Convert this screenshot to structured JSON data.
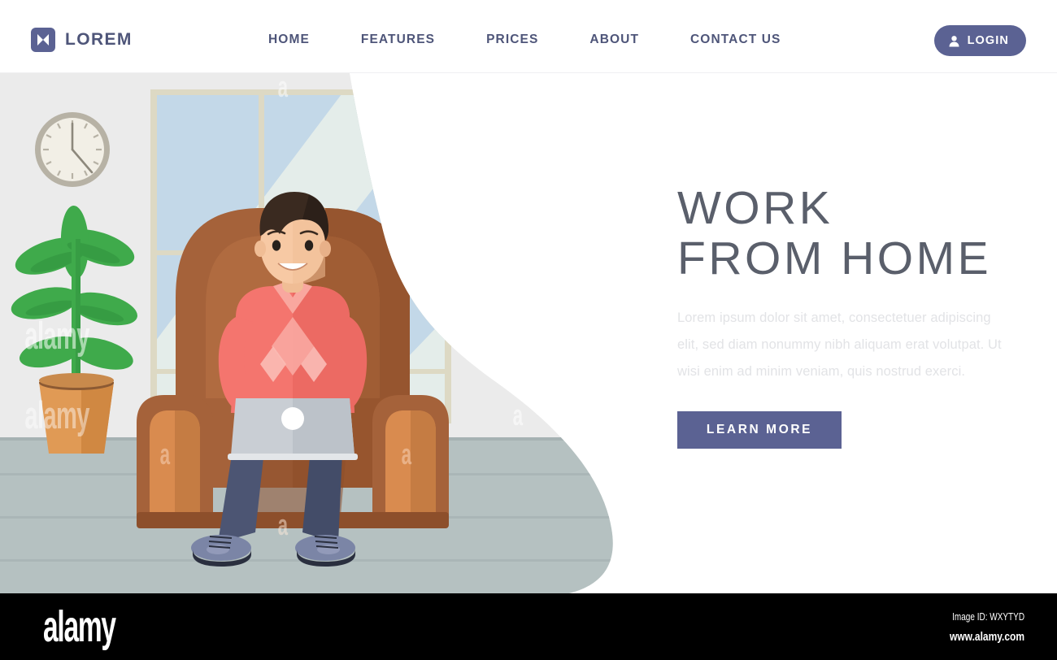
{
  "navbar": {
    "brand": {
      "name": "LOREM",
      "icon": "bowtie-logo-icon",
      "color": "#5b6293"
    },
    "links": [
      {
        "label": "HOME"
      },
      {
        "label": "FEATURES"
      },
      {
        "label": "PRICES"
      },
      {
        "label": "ABOUT"
      },
      {
        "label": "CONTACT US"
      }
    ],
    "login": {
      "label": "LOGIN",
      "icon": "user-icon"
    }
  },
  "hero": {
    "title": "WORK\nFROM HOME",
    "paragraph": "Lorem ipsum dolor sit amet, consectetuer adipiscing elit, sed diam nonummy nibh aliquam erat volutpat. Ut wisi enim ad minim veniam, quis nostrud exerci.",
    "cta_label": "LEARN MORE"
  },
  "illustration": {
    "scene": "man-working-from-home-in-armchair-with-laptop",
    "objects": [
      "wall-clock",
      "potted-plant",
      "window",
      "armchair",
      "person",
      "laptop",
      "floor"
    ],
    "palette": {
      "wall": "#ebebeb",
      "floor": "#b5c1c1",
      "window_glass": "#c3d8e8",
      "window_frame": "#ddd9c4",
      "chair_brown": "#a5623a",
      "chair_light": "#d98b4f",
      "sweater_pink": "#f4756e",
      "jeans_blue": "#4c5573",
      "skin": "#f7c9a4",
      "hair": "#3a2a20",
      "laptop_gray": "#c9ced4",
      "plant_green": "#45b04e",
      "pot_orange": "#e09a55"
    }
  },
  "watermark": {
    "brand": "alamy",
    "image_id": "Image ID: WXYTYD",
    "url": "www.alamy.com",
    "tiles": [
      "alamy",
      "a",
      "alamy",
      "a",
      "a",
      "a"
    ]
  }
}
